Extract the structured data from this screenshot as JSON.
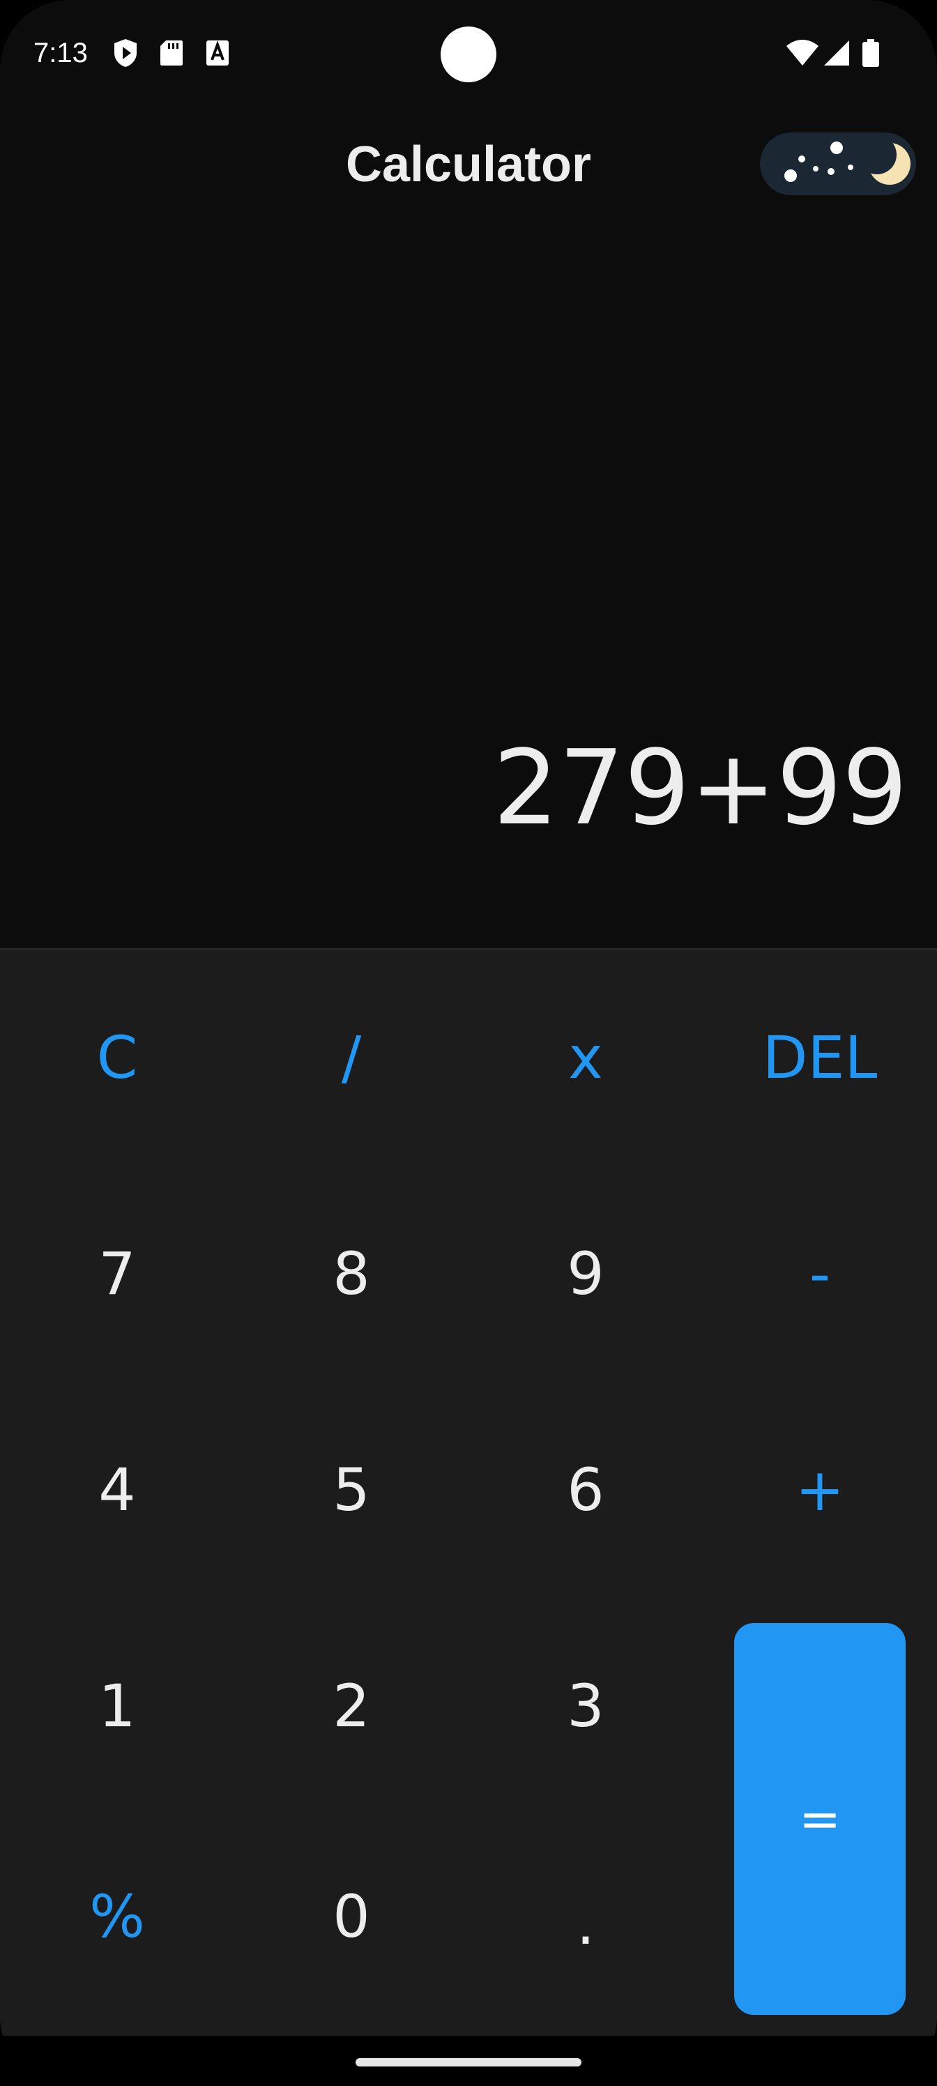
{
  "status_bar": {
    "time": "7:13",
    "left_icons": [
      "shield-play-icon",
      "sd-card-icon",
      "font-a-icon"
    ],
    "right_icons": [
      "wifi-icon",
      "cellular-signal-icon",
      "battery-icon"
    ]
  },
  "header": {
    "title": "Calculator",
    "theme_toggle_icon": "night-moon-icon"
  },
  "display": {
    "expression": "279+99"
  },
  "keypad": {
    "rows": [
      [
        {
          "label": "C",
          "name": "clear-button",
          "type": "op"
        },
        {
          "label": "/",
          "name": "divide-button",
          "type": "op"
        },
        {
          "label": "x",
          "name": "multiply-button",
          "type": "op"
        },
        {
          "label": "DEL",
          "name": "delete-button",
          "type": "op"
        }
      ],
      [
        {
          "label": "7",
          "name": "digit-7-button",
          "type": "digit"
        },
        {
          "label": "8",
          "name": "digit-8-button",
          "type": "digit"
        },
        {
          "label": "9",
          "name": "digit-9-button",
          "type": "digit"
        },
        {
          "label": "-",
          "name": "subtract-button",
          "type": "op"
        }
      ],
      [
        {
          "label": "4",
          "name": "digit-4-button",
          "type": "digit"
        },
        {
          "label": "5",
          "name": "digit-5-button",
          "type": "digit"
        },
        {
          "label": "6",
          "name": "digit-6-button",
          "type": "digit"
        },
        {
          "label": "+",
          "name": "add-button",
          "type": "op"
        }
      ],
      [
        {
          "label": "1",
          "name": "digit-1-button",
          "type": "digit"
        },
        {
          "label": "2",
          "name": "digit-2-button",
          "type": "digit"
        },
        {
          "label": "3",
          "name": "digit-3-button",
          "type": "digit"
        }
      ],
      [
        {
          "label": "%",
          "name": "percent-button",
          "type": "op"
        },
        {
          "label": "0",
          "name": "digit-0-button",
          "type": "digit"
        },
        {
          "label": ".",
          "name": "decimal-point-button",
          "type": "digit"
        }
      ]
    ],
    "equals": {
      "label": "=",
      "name": "equals-button"
    }
  },
  "colors": {
    "accent": "#2196f3",
    "background": "#0c0c0c",
    "keypad_background": "#1c1c1c",
    "text": "#ededed"
  }
}
